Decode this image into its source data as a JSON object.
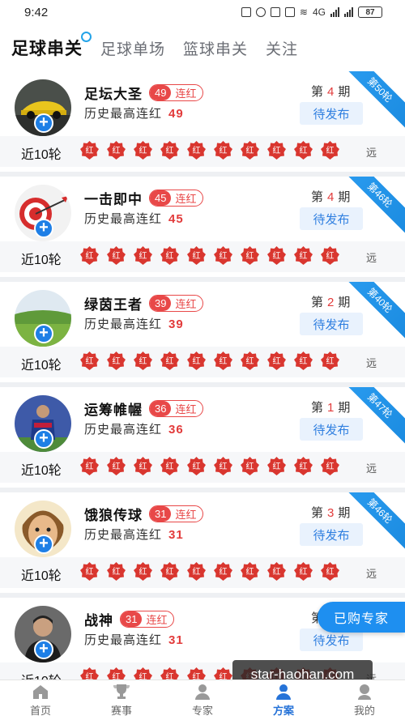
{
  "status_bar": {
    "time": "9:42",
    "battery": "87",
    "network": "4G"
  },
  "top_tabs": [
    {
      "label": "足球串关",
      "active": true
    },
    {
      "label": "足球单场",
      "active": false
    },
    {
      "label": "篮球串关",
      "active": false
    },
    {
      "label": "关注",
      "active": false
    }
  ],
  "labels": {
    "streak_suffix": "连红",
    "history_prefix": "历史最高连红",
    "period_prefix": "第",
    "period_suffix": "期",
    "pending": "待发布",
    "recent": "近10轮",
    "far": "远",
    "badge_text": "红"
  },
  "experts": [
    {
      "name": "足坛大圣",
      "streak": "49",
      "history": "49",
      "period": "4",
      "ribbon": "第50轮",
      "avatar": "car"
    },
    {
      "name": "一击即中",
      "streak": "45",
      "history": "45",
      "period": "4",
      "ribbon": "第46轮",
      "avatar": "target"
    },
    {
      "name": "绿茵王者",
      "streak": "39",
      "history": "39",
      "period": "2",
      "ribbon": "第40轮",
      "avatar": "field"
    },
    {
      "name": "运筹帷幄",
      "streak": "36",
      "history": "36",
      "period": "1",
      "ribbon": "第47轮",
      "avatar": "player"
    },
    {
      "name": "饿狼传球",
      "streak": "31",
      "history": "31",
      "period": "3",
      "ribbon": "第46轮",
      "avatar": "face"
    },
    {
      "name": "战神",
      "streak": "31",
      "history": "31",
      "period": "",
      "ribbon": "",
      "avatar": "man"
    }
  ],
  "floating": {
    "purchased": "已购专家",
    "watermark": "star-haohan.com"
  },
  "bottom_nav": [
    {
      "label": "首页",
      "icon": "home-icon",
      "active": false
    },
    {
      "label": "赛事",
      "icon": "trophy-icon",
      "active": false
    },
    {
      "label": "专家",
      "icon": "expert-icon",
      "active": false
    },
    {
      "label": "方案",
      "icon": "plan-icon",
      "active": true
    },
    {
      "label": "我的",
      "icon": "profile-icon",
      "active": false
    }
  ],
  "colors": {
    "accent_blue": "#1e8ff0",
    "red": "#e23b3b",
    "badge_red": "#d9362f"
  }
}
